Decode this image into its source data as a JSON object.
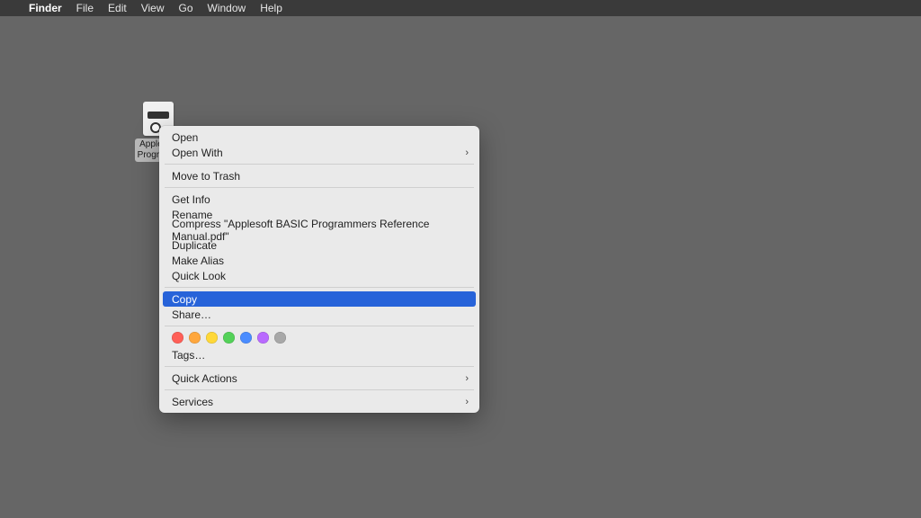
{
  "menubar": {
    "app": "Finder",
    "items": [
      "File",
      "Edit",
      "View",
      "Go",
      "Window",
      "Help"
    ]
  },
  "desktop": {
    "file_label": "Applesoft\nProgramm"
  },
  "context_menu": {
    "open": "Open",
    "open_with": "Open With",
    "move_to_trash": "Move to Trash",
    "get_info": "Get Info",
    "rename": "Rename",
    "compress": "Compress \"Applesoft BASIC Programmers Reference Manual.pdf\"",
    "duplicate": "Duplicate",
    "make_alias": "Make Alias",
    "quick_look": "Quick Look",
    "copy": "Copy",
    "share": "Share…",
    "tags": "Tags…",
    "quick_actions": "Quick Actions",
    "services": "Services",
    "tag_colors": [
      "#ff5f57",
      "#ffa73d",
      "#ffd838",
      "#53d158",
      "#4a8cff",
      "#b96aff",
      "#a8a8a8"
    ]
  }
}
